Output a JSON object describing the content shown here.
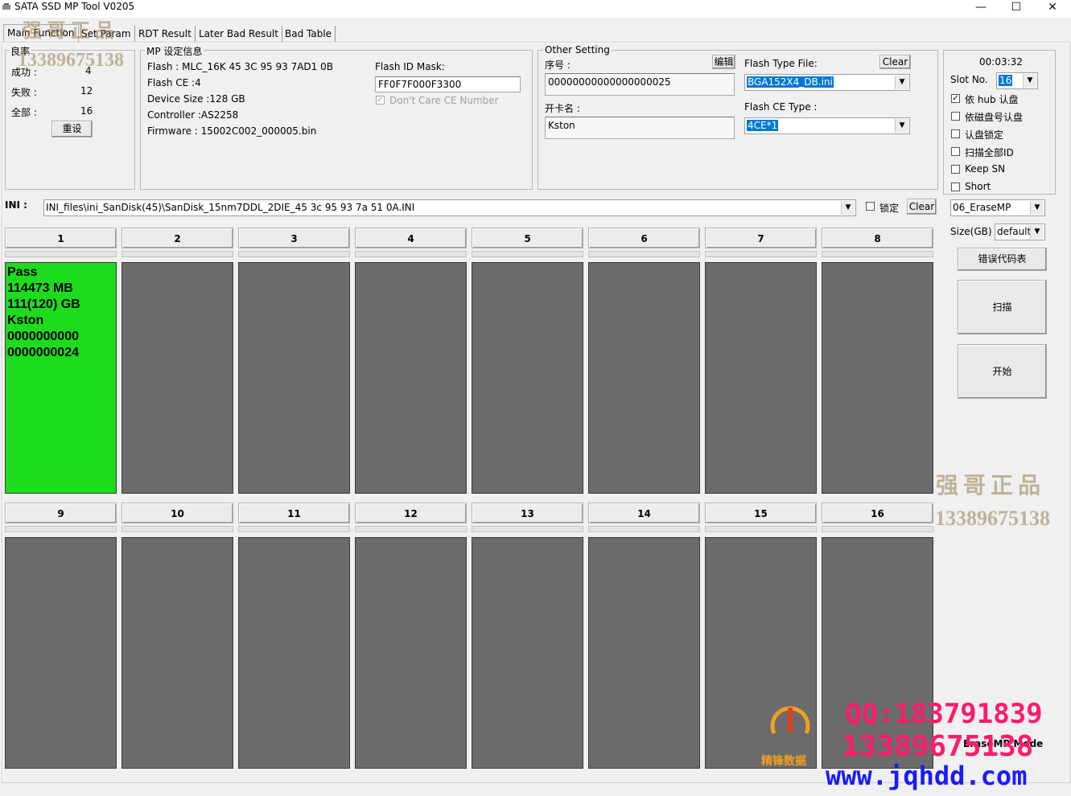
{
  "window": {
    "title": "SATA SSD MP Tool V0205",
    "minimize": "—",
    "maximize": "☐",
    "close": "✕"
  },
  "tabs": [
    {
      "label": "Main Function"
    },
    {
      "label": "Set Param"
    },
    {
      "label": "RDT Result"
    },
    {
      "label": "Later Bad Result"
    },
    {
      "label": "Bad Table"
    }
  ],
  "yield": {
    "legend": "良率",
    "success_label": "成功 :",
    "success_value": "4",
    "fail_label": "失败 :",
    "fail_value": "12",
    "total_label": "全部 :",
    "total_value": "16",
    "reset_button": "重设"
  },
  "mp": {
    "legend": "MP 设定信息",
    "flash": "Flash : MLC_16K 45 3C 95 93 7AD1 0B",
    "flash_ce": "Flash CE :4",
    "device_size": "Device Size :128 GB",
    "controller": "Controller :AS2258",
    "firmware": "Firmware : 15002C002_000005.bin",
    "flash_id_mask_label": "Flash ID Mask:",
    "flash_id_mask_value": "FF0F7F000F3300",
    "dont_care_label": "Don't Care CE Number"
  },
  "other": {
    "legend": "Other Setting",
    "serial_label": "序号 :",
    "edit_button": "编辑",
    "serial_value": "00000000000000000025",
    "card_name_label": "开卡名 :",
    "card_name_value": "Kston",
    "flash_type_file_label": "Flash Type File:",
    "clear_button": "Clear",
    "flash_type_file_value": "BGA152X4_DB.ini",
    "flash_ce_type_label": "Flash CE Type :",
    "flash_ce_type_value": "4CE*1"
  },
  "right": {
    "timer": "00:03:32",
    "slot_no_label": "Slot No.",
    "slot_no_value": "16",
    "options": [
      {
        "label": "依 hub 认盘",
        "checked": true
      },
      {
        "label": "依磁盘号认盘",
        "checked": false
      },
      {
        "label": "认盘锁定",
        "checked": false
      },
      {
        "label": "扫描全部ID",
        "checked": false
      },
      {
        "label": "Keep SN",
        "checked": false
      },
      {
        "label": "Short",
        "checked": false
      }
    ],
    "mode_value": "06_EraseMP",
    "size_label": "Size(GB)",
    "size_value": "default",
    "error_code_button": "错误代码表",
    "scan_button": "扫描",
    "start_button": "开始",
    "mode_status": "EraseMP Mode"
  },
  "ini": {
    "label": "INI :",
    "value": "INI_files\\ini_SanDisk(45)\\SanDisk_15nm7DDL_2DIE_45 3c 95 93 7a 51 0A.INI",
    "lock_label": "锁定",
    "clear_button": "Clear"
  },
  "slots": [
    {
      "num": "1",
      "status": "pass",
      "lines": [
        "Pass",
        "114473 MB",
        "111(120) GB",
        "Kston",
        "0000000000",
        "0000000024"
      ]
    },
    {
      "num": "2",
      "status": "idle",
      "lines": []
    },
    {
      "num": "3",
      "status": "idle",
      "lines": []
    },
    {
      "num": "4",
      "status": "idle",
      "lines": []
    },
    {
      "num": "5",
      "status": "idle",
      "lines": []
    },
    {
      "num": "6",
      "status": "idle",
      "lines": []
    },
    {
      "num": "7",
      "status": "idle",
      "lines": []
    },
    {
      "num": "8",
      "status": "idle",
      "lines": []
    },
    {
      "num": "9",
      "status": "idle",
      "lines": []
    },
    {
      "num": "10",
      "status": "idle",
      "lines": []
    },
    {
      "num": "11",
      "status": "idle",
      "lines": []
    },
    {
      "num": "12",
      "status": "idle",
      "lines": []
    },
    {
      "num": "13",
      "status": "idle",
      "lines": []
    },
    {
      "num": "14",
      "status": "idle",
      "lines": []
    },
    {
      "num": "15",
      "status": "idle",
      "lines": []
    },
    {
      "num": "16",
      "status": "idle",
      "lines": []
    }
  ],
  "watermarks": {
    "brand_cn": "强哥正品",
    "phone": "13389675138",
    "logo_text": "精锋数据",
    "qq": "QQ:183791839",
    "phone2": "13389675138",
    "url": "www.jqhdd.com"
  },
  "colors": {
    "pass": "#1ddc1d",
    "idle": "#6b6b6b",
    "ad_red": "#ff1a6e",
    "ad_blue": "#1a1aff",
    "selection": "#0078d7"
  }
}
